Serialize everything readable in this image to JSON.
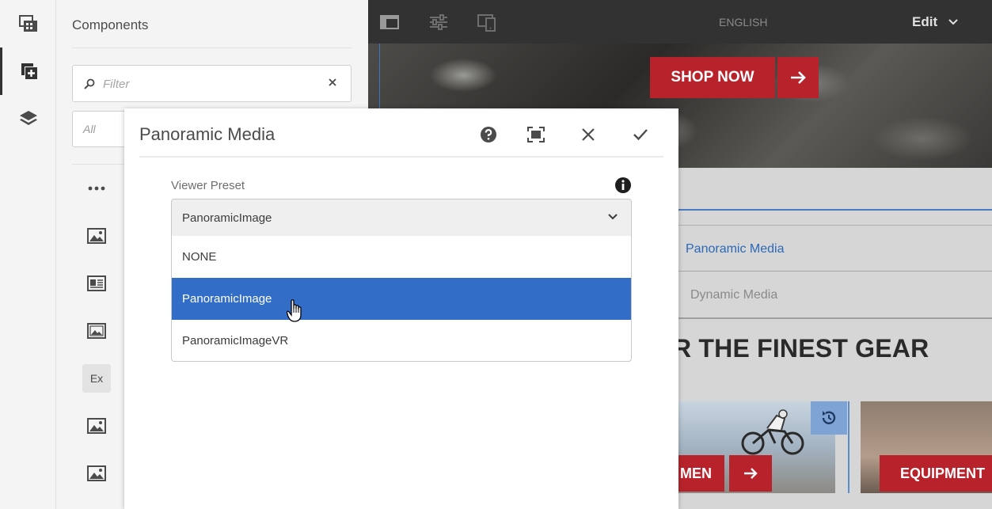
{
  "sidebar_rail": {
    "items": [
      {
        "icon": "assets-icon"
      },
      {
        "icon": "components-icon",
        "active": true
      },
      {
        "icon": "layers-icon"
      }
    ]
  },
  "components_panel": {
    "title": "Components",
    "filter_placeholder": "Filter",
    "group_select": "All",
    "items": [
      {
        "icon": "more-icon"
      },
      {
        "icon": "image-icon"
      },
      {
        "icon": "image-card-icon"
      },
      {
        "icon": "image-gallery-icon"
      },
      {
        "icon": "ex-badge",
        "label": "Ex"
      },
      {
        "icon": "image-icon"
      },
      {
        "icon": "image-icon"
      }
    ]
  },
  "toolbar": {
    "language": "ENGLISH",
    "mode": "Edit"
  },
  "canvas": {
    "shop_now": "SHOP NOW",
    "tab_panoramic": "Panoramic Media",
    "tab_dynamic": "Dynamic Media",
    "heading": "R THE FINEST GEAR",
    "men_label": "MEN",
    "equipment_label": "EQUIPMENT",
    "colors": {
      "brand_red": "#b8232b",
      "selection_blue": "#326ec8"
    }
  },
  "dialog": {
    "title": "Panoramic Media",
    "field_label": "Viewer Preset",
    "selected_value": "PanoramicImage",
    "options": [
      {
        "label": "NONE",
        "selected": false
      },
      {
        "label": "PanoramicImage",
        "selected": true
      },
      {
        "label": "PanoramicImageVR",
        "selected": false
      }
    ]
  }
}
